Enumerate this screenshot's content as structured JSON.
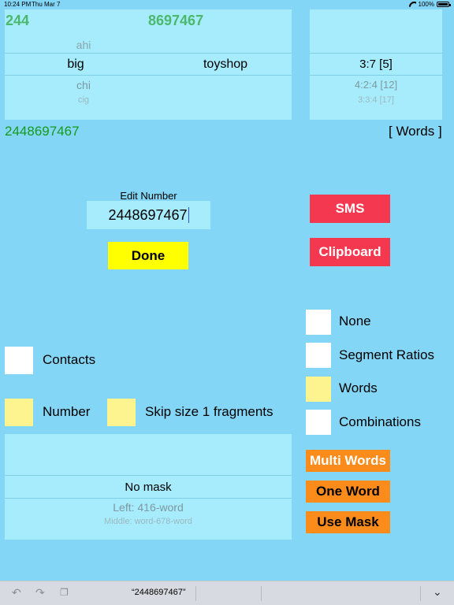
{
  "status_bar": {
    "time": "10:24 PM",
    "date": "Thu Mar 7",
    "battery": "100%"
  },
  "picker_main": {
    "head_left": "244",
    "head_right": "8697467",
    "rows": [
      {
        "left": "ahi",
        "right": ""
      },
      {
        "left": "big",
        "right": "toyshop"
      },
      {
        "left": "chi",
        "right": ""
      },
      {
        "left": "cig",
        "right": ""
      }
    ]
  },
  "picker_ratio": {
    "rows": [
      "3:7  [5]",
      "4:2:4  [12]",
      "3:3:4  [17]"
    ]
  },
  "full_number": "2448697467",
  "words_link": "[ Words ]",
  "edit": {
    "label": "Edit Number",
    "value": "2448697467"
  },
  "buttons": {
    "done": "Done",
    "sms": "SMS",
    "clipboard": "Clipboard",
    "multi_words": "Multi Words",
    "one_word": "One Word",
    "use_mask": "Use Mask"
  },
  "options": {
    "none": {
      "label": "None",
      "checked": false
    },
    "segment_ratios": {
      "label": "Segment Ratios",
      "checked": false
    },
    "words": {
      "label": "Words",
      "checked": true
    },
    "combinations": {
      "label": "Combinations",
      "checked": false
    }
  },
  "filters": {
    "contacts": {
      "label": "Contacts",
      "checked": false
    },
    "number": {
      "label": "Number",
      "checked": true
    },
    "skip": {
      "label": "Skip size 1 fragments",
      "checked": true
    }
  },
  "mask_picker": {
    "rows": [
      "No mask",
      "Left: 416-word",
      "Middle: word-678-word"
    ]
  },
  "toolbar": {
    "suggestion": "“2448697467”"
  },
  "colors": {
    "background": "#84d6f6",
    "picker": "#a6ecfc",
    "done": "#ffff00",
    "red": "#f4384f",
    "orange": "#fb8c1c",
    "checked": "#fdf38f"
  }
}
